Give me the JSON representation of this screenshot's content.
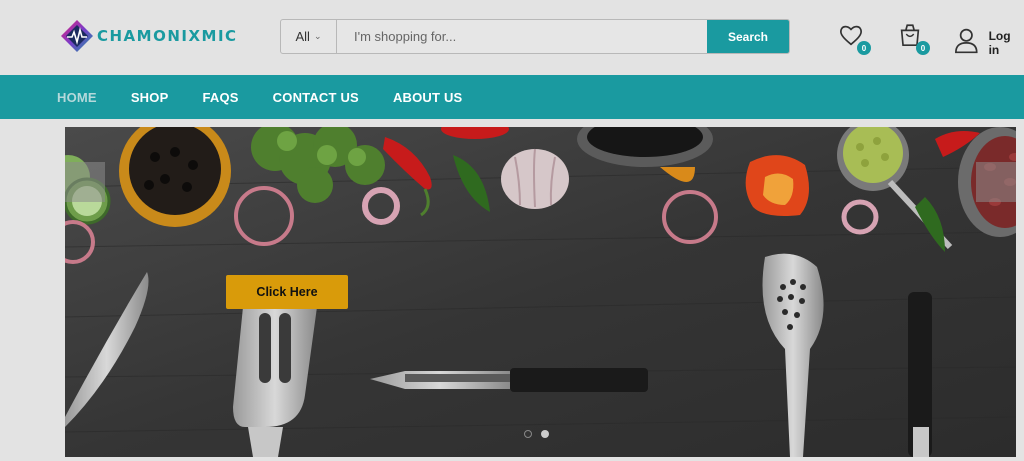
{
  "brand": {
    "name": "CHAMONIXMIC"
  },
  "search": {
    "category": "All",
    "placeholder": "I'm shopping for...",
    "button": "Search"
  },
  "header": {
    "wishlist_count": "0",
    "cart_count": "0",
    "login_label": "Log in"
  },
  "nav": {
    "items": [
      "HOME",
      "SHOP",
      "FAQS",
      "CONTACT US",
      "ABOUT US"
    ],
    "active": "HOME"
  },
  "hero": {
    "cta_label": "Click Here",
    "slide_count": 2,
    "active_slide": 1
  },
  "colors": {
    "accent": "#1a9aa0",
    "cta": "#d99b0a",
    "background": "#e3e3e3"
  }
}
